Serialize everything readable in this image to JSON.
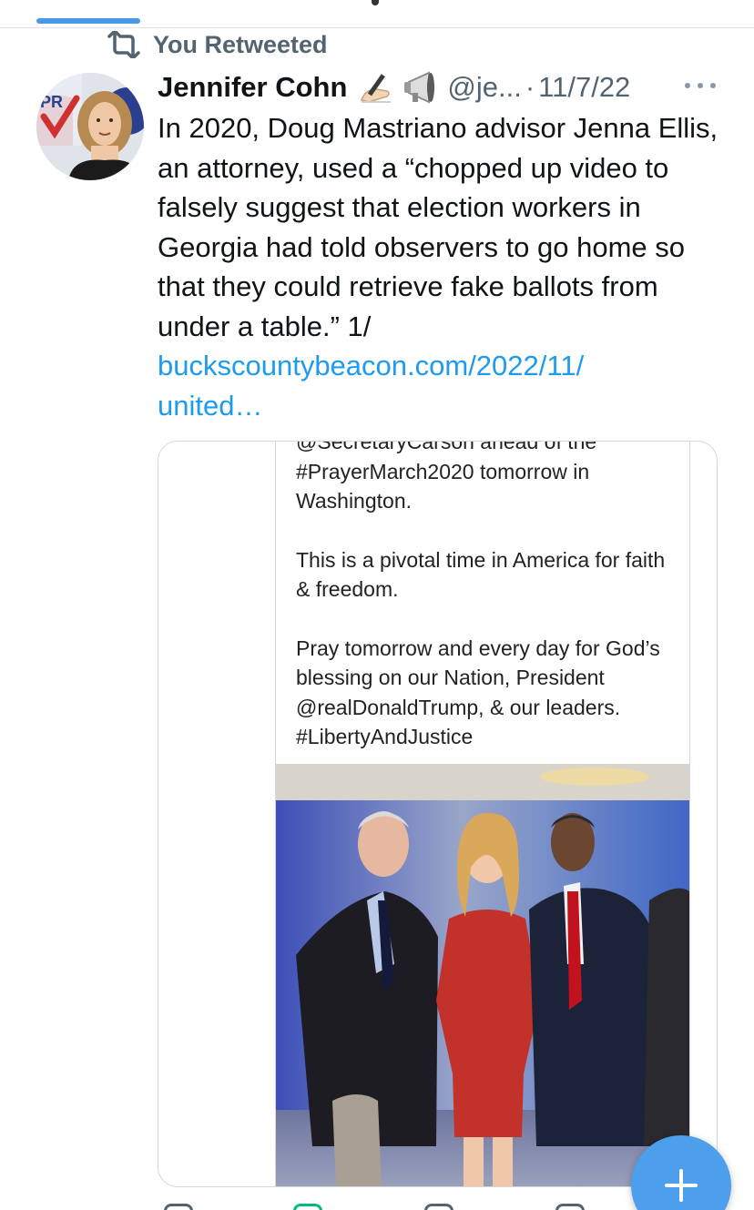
{
  "retweet_banner": {
    "label": "You Retweeted",
    "icon": "retweet-icon"
  },
  "tweet": {
    "author_name": "Jennifer Cohn",
    "author_emojis": [
      "writing-hand-emoji",
      "megaphone-emoji"
    ],
    "handle": "@je...",
    "separator": "·",
    "date": "11/7/22",
    "text": "In 2020, Doug Mastriano advisor Jenna Ellis, an attorney, used a “chopped up video to falsely suggest that election workers in Georgia had told observers to go home so that they could retrieve fake ballots from under a table.” 1/",
    "link_line_1": "buckscountybeacon.com/2022/11/",
    "link_line_2": "united…",
    "link_color": "#1d9bf0"
  },
  "media": {
    "embedded_tweet_lines": {
      "cut_top": "@SecretaryCarson ahead of the",
      "line_2": "#PrayerMarch2020 tomorrow in",
      "line_3": "Washington.",
      "para_2": "This is a pivotal time in America for faith & freedom.",
      "para_3": "Pray tomorrow and every day for God’s blessing on our Nation, President @realDonaldTrump, & our leaders. #LibertyAndJustice"
    },
    "photo_description_icon": "photo-of-three-people"
  },
  "fab": {
    "icon": "plus-icon",
    "color": "#4d9fec"
  },
  "colors": {
    "accent": "#1d9bf0",
    "muted": "#536471",
    "tab_indicator": "#4a99e9"
  }
}
